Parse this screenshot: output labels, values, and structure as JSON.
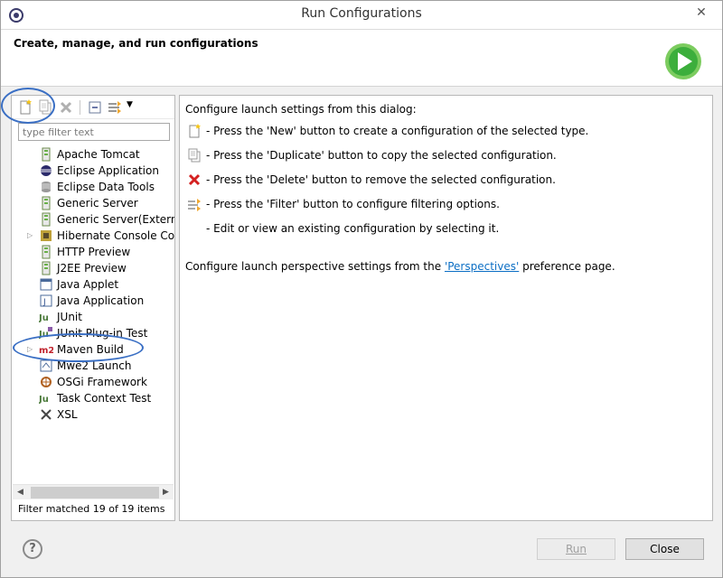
{
  "window": {
    "title": "Run Configurations"
  },
  "banner": {
    "title": "Create, manage, and run configurations"
  },
  "filter": {
    "placeholder": "type filter text"
  },
  "tree": {
    "items": [
      {
        "label": "Apache Tomcat",
        "icon": "server-icon",
        "expandable": false
      },
      {
        "label": "Eclipse Application",
        "icon": "eclipse-icon",
        "expandable": false
      },
      {
        "label": "Eclipse Data Tools",
        "icon": "database-icon",
        "expandable": false
      },
      {
        "label": "Generic Server",
        "icon": "server-icon",
        "expandable": false
      },
      {
        "label": "Generic Server(External L",
        "icon": "server-icon",
        "expandable": false
      },
      {
        "label": "Hibernate Console Conf",
        "icon": "hibernate-icon",
        "expandable": true
      },
      {
        "label": "HTTP Preview",
        "icon": "server-icon",
        "expandable": false
      },
      {
        "label": "J2EE Preview",
        "icon": "server-icon",
        "expandable": false
      },
      {
        "label": "Java Applet",
        "icon": "applet-icon",
        "expandable": false
      },
      {
        "label": "Java Application",
        "icon": "java-app-icon",
        "expandable": false
      },
      {
        "label": "JUnit",
        "icon": "junit-icon",
        "expandable": false
      },
      {
        "label": "JUnit Plug-in Test",
        "icon": "junit-plugin-icon",
        "expandable": false
      },
      {
        "label": "Maven Build",
        "icon": "maven-icon",
        "expandable": true
      },
      {
        "label": "Mwe2 Launch",
        "icon": "mwe2-icon",
        "expandable": false
      },
      {
        "label": "OSGi Framework",
        "icon": "osgi-icon",
        "expandable": false
      },
      {
        "label": "Task Context Test",
        "icon": "junit-icon",
        "expandable": false
      },
      {
        "label": "XSL",
        "icon": "xsl-icon",
        "expandable": false
      }
    ]
  },
  "status": {
    "text": "Filter matched 19 of 19 items"
  },
  "right": {
    "intro": "Configure launch settings from this dialog:",
    "instructions": [
      {
        "icon": "new-config-icon",
        "text": "- Press the 'New' button to create a configuration of the selected type."
      },
      {
        "icon": "duplicate-icon",
        "text": "- Press the 'Duplicate' button to copy the selected configuration."
      },
      {
        "icon": "delete-icon",
        "text": "- Press the 'Delete' button to remove the selected configuration."
      },
      {
        "icon": "filter-icon",
        "text": "- Press the 'Filter' button to configure filtering options."
      },
      {
        "icon": "",
        "text": "- Edit or view an existing configuration by selecting it."
      }
    ],
    "perspectives_prefix": "Configure launch perspective settings from the ",
    "perspectives_link": "'Perspectives'",
    "perspectives_suffix": " preference page."
  },
  "buttons": {
    "run": "Run",
    "close": "Close",
    "help": "?"
  },
  "colors": {
    "accent": "#3a6fc4",
    "link": "#0b6ec4",
    "run_green": "#3cae3c"
  }
}
